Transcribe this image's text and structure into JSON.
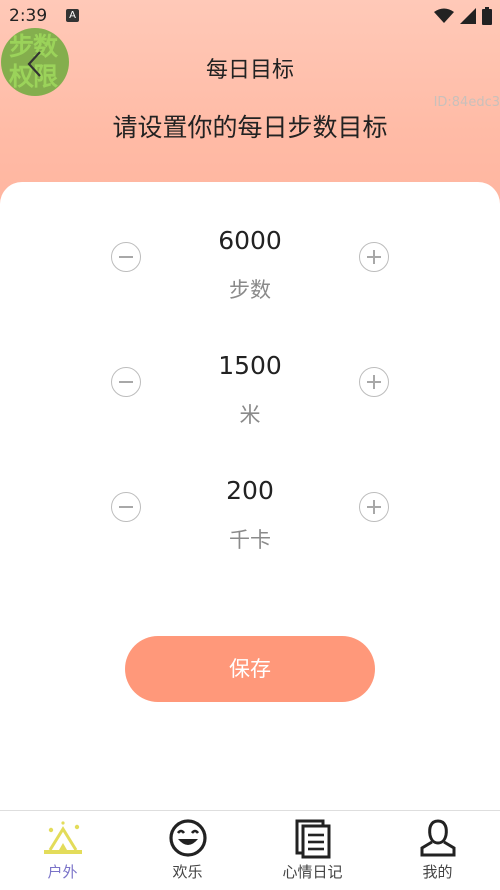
{
  "status_bar": {
    "time": "2:39",
    "badge": "A"
  },
  "header": {
    "back_overlay_text": "步数权限",
    "title": "每日目标",
    "id_text": "ID:84edc3",
    "subtitle": "请设置你的每日步数目标"
  },
  "goals": [
    {
      "value": "6000",
      "unit": "步数"
    },
    {
      "value": "1500",
      "unit": "米"
    },
    {
      "value": "200",
      "unit": "千卡"
    }
  ],
  "save_label": "保存",
  "tabs": [
    {
      "label": "户外",
      "icon": "camp-icon",
      "active": true
    },
    {
      "label": "欢乐",
      "icon": "smile-icon",
      "active": false
    },
    {
      "label": "心情日记",
      "icon": "diary-icon",
      "active": false
    },
    {
      "label": "我的",
      "icon": "user-icon",
      "active": false
    }
  ],
  "colors": {
    "header_gradient_top": "#ffc9b8",
    "header_gradient_bottom": "#ffb39d",
    "save_button": "#ff987a",
    "active_tab_label": "#7a73c8",
    "active_tab_icon": "#e3dc5a"
  }
}
